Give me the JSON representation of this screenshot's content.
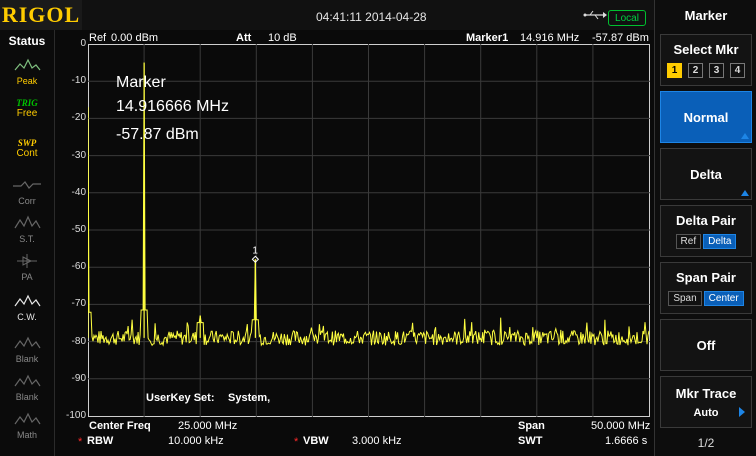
{
  "topbar": {
    "logo": "RIGOL",
    "datetime": "04:41:11 2014-04-28",
    "local_label": "Local"
  },
  "status": {
    "title": "Status",
    "items": [
      {
        "top": "Peak",
        "bottom": "",
        "active": true
      },
      {
        "top": "TRIG",
        "bottom": "Free",
        "active": true
      },
      {
        "top": "SWP",
        "bottom": "Cont",
        "active": true
      },
      {
        "top": "",
        "bottom": "Corr",
        "active": false
      },
      {
        "top": "",
        "bottom": "S.T.",
        "active": false
      },
      {
        "top": "",
        "bottom": "PA",
        "active": false
      },
      {
        "top": "",
        "bottom": "C.W.",
        "active": true
      },
      {
        "top": "",
        "bottom": "Blank",
        "active": false
      },
      {
        "top": "",
        "bottom": "Blank",
        "active": false
      },
      {
        "top": "",
        "bottom": "Math",
        "active": false
      }
    ]
  },
  "screen": {
    "ref": "Ref",
    "ref_value": "0.00 dBm",
    "att": "Att",
    "att_value": "10 dB",
    "marker_header": "Marker1",
    "marker_freq_header": "14.916 MHz",
    "marker_amp_header": "-57.87 dBm",
    "marker_box": {
      "title": "Marker",
      "freq": "14.916666 MHz",
      "amp": "-57.87 dBm"
    },
    "userkey": "UserKey Set:",
    "userkey_value": "System,",
    "center_freq_label": "Center Freq",
    "center_freq_value": "25.000 MHz",
    "span_label": "Span",
    "span_value": "50.000 MHz",
    "rbw_label": "RBW",
    "rbw_value": "10.000 kHz",
    "vbw_label": "VBW",
    "vbw_value": "3.000 kHz",
    "swt_label": "SWT",
    "swt_value": "1.6666 s",
    "star": "*",
    "marker_number": "1"
  },
  "chart_data": {
    "type": "line",
    "yticks": [
      "0",
      "-10",
      "-20",
      "-30",
      "-40",
      "-50",
      "-60",
      "-70",
      "-80",
      "-90",
      "-100"
    ],
    "ylim": [
      -100,
      0
    ],
    "xlim": [
      0,
      50
    ],
    "noise_floor": -79,
    "peaks": [
      {
        "x": 0.0,
        "y": -17
      },
      {
        "x": 5.0,
        "y": -5
      },
      {
        "x": 10.0,
        "y": -73
      },
      {
        "x": 14.917,
        "y": -57.87
      }
    ],
    "trace_color": "#ffff40"
  },
  "panel": {
    "title": "Marker",
    "select_mkr": "Select Mkr",
    "mkr_numbers": [
      "1",
      "2",
      "3",
      "4"
    ],
    "normal": "Normal",
    "delta": "Delta",
    "delta_pair": "Delta Pair",
    "ref": "Ref",
    "delta_short": "Delta",
    "span_pair": "Span Pair",
    "span": "Span",
    "center": "Center",
    "off": "Off",
    "mkr_trace": "Mkr Trace",
    "auto": "Auto",
    "page": "1/2"
  }
}
